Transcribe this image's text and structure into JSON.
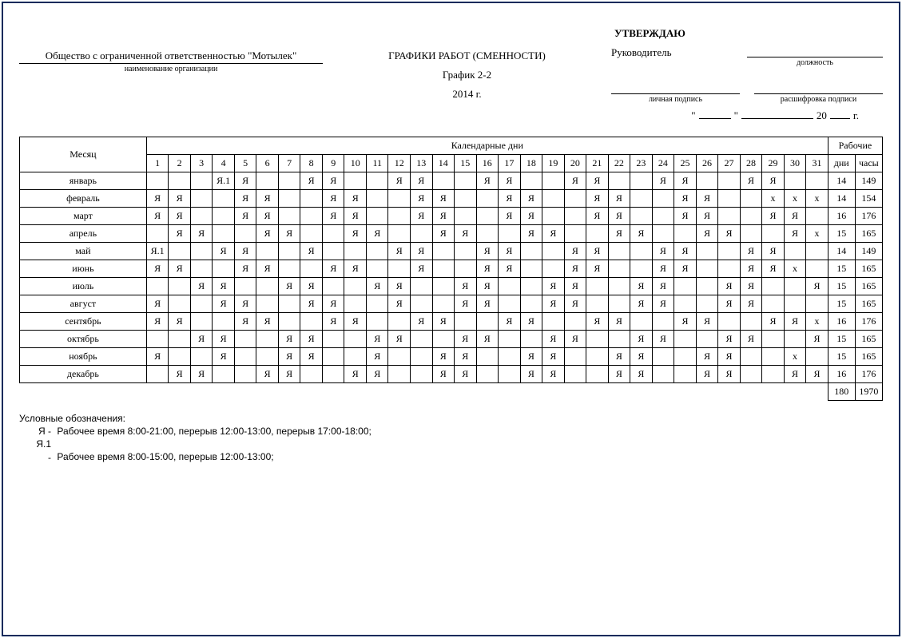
{
  "header": {
    "org_name": "Общество с ограниченной ответственностью \"Мотылек\"",
    "org_label": "наименование организации",
    "title": "ГРАФИКИ РАБОТ (СМЕННОСТИ)",
    "schedule_name": "График 2-2",
    "year": "2014 г."
  },
  "approve": {
    "title": "УТВЕРЖДАЮ",
    "role": "Руководитель",
    "position_label": "должность",
    "sign_label": "личная подпись",
    "decode_label": "расшифровка подписи",
    "year_prefix": "20",
    "year_suffix": "г."
  },
  "table": {
    "month_header": "Месяц",
    "days_header": "Календарные дни",
    "work_header": "Рабочие",
    "dni": "дни",
    "hours": "часы",
    "day_numbers": [
      "1",
      "2",
      "3",
      "4",
      "5",
      "6",
      "7",
      "8",
      "9",
      "10",
      "11",
      "12",
      "13",
      "14",
      "15",
      "16",
      "17",
      "18",
      "19",
      "20",
      "21",
      "22",
      "23",
      "24",
      "25",
      "26",
      "27",
      "28",
      "29",
      "30",
      "31"
    ],
    "rows": [
      {
        "m": "январь",
        "d": [
          "",
          "",
          "",
          "Я.1",
          "Я",
          "",
          "",
          "Я",
          "Я",
          "",
          "",
          "Я",
          "Я",
          "",
          "",
          "Я",
          "Я",
          "",
          "",
          "Я",
          "Я",
          "",
          "",
          "Я",
          "Я",
          "",
          "",
          "Я",
          "Я",
          "",
          ""
        ],
        "days": "14",
        "hrs": "149"
      },
      {
        "m": "февраль",
        "d": [
          "Я",
          "Я",
          "",
          "",
          "Я",
          "Я",
          "",
          "",
          "Я",
          "Я",
          "",
          "",
          "Я",
          "Я",
          "",
          "",
          "Я",
          "Я",
          "",
          "",
          "Я",
          "Я",
          "",
          "",
          "Я",
          "Я",
          "",
          "",
          "х",
          "х",
          "х"
        ],
        "days": "14",
        "hrs": "154"
      },
      {
        "m": "март",
        "d": [
          "Я",
          "Я",
          "",
          "",
          "Я",
          "Я",
          "",
          "",
          "Я",
          "Я",
          "",
          "",
          "Я",
          "Я",
          "",
          "",
          "Я",
          "Я",
          "",
          "",
          "Я",
          "Я",
          "",
          "",
          "Я",
          "Я",
          "",
          "",
          "Я",
          "Я",
          ""
        ],
        "days": "16",
        "hrs": "176"
      },
      {
        "m": "апрель",
        "d": [
          "",
          "Я",
          "Я",
          "",
          "",
          "Я",
          "Я",
          "",
          "",
          "Я",
          "Я",
          "",
          "",
          "Я",
          "Я",
          "",
          "",
          "Я",
          "Я",
          "",
          "",
          "Я",
          "Я",
          "",
          "",
          "Я",
          "Я",
          "",
          "",
          "Я",
          "х"
        ],
        "days": "15",
        "hrs": "165"
      },
      {
        "m": "май",
        "d": [
          "Я.1",
          "",
          "",
          "Я",
          "Я",
          "",
          "",
          "Я",
          "",
          "",
          "",
          "Я",
          "Я",
          "",
          "",
          "Я",
          "Я",
          "",
          "",
          "Я",
          "Я",
          "",
          "",
          "Я",
          "Я",
          "",
          "",
          "Я",
          "Я",
          "",
          ""
        ],
        "days": "14",
        "hrs": "149"
      },
      {
        "m": "июнь",
        "d": [
          "Я",
          "Я",
          "",
          "",
          "Я",
          "Я",
          "",
          "",
          "Я",
          "Я",
          "",
          "",
          "Я",
          "",
          "",
          "Я",
          "Я",
          "",
          "",
          "Я",
          "Я",
          "",
          "",
          "Я",
          "Я",
          "",
          "",
          "Я",
          "Я",
          "х"
        ],
        "days": "15",
        "hrs": "165"
      },
      {
        "m": "июль",
        "d": [
          "",
          "",
          "Я",
          "Я",
          "",
          "",
          "Я",
          "Я",
          "",
          "",
          "Я",
          "Я",
          "",
          "",
          "Я",
          "Я",
          "",
          "",
          "Я",
          "Я",
          "",
          "",
          "Я",
          "Я",
          "",
          "",
          "Я",
          "Я",
          "",
          "",
          "Я"
        ],
        "days": "15",
        "hrs": "165"
      },
      {
        "m": "август",
        "d": [
          "Я",
          "",
          "",
          "Я",
          "Я",
          "",
          "",
          "Я",
          "Я",
          "",
          "",
          "Я",
          "",
          "",
          "Я",
          "Я",
          "",
          "",
          "Я",
          "Я",
          "",
          "",
          "Я",
          "Я",
          "",
          "",
          "Я",
          "Я",
          "",
          "",
          ""
        ],
        "days": "15",
        "hrs": "165"
      },
      {
        "m": "сентябрь",
        "d": [
          "Я",
          "Я",
          "",
          "",
          "Я",
          "Я",
          "",
          "",
          "Я",
          "Я",
          "",
          "",
          "Я",
          "Я",
          "",
          "",
          "Я",
          "Я",
          "",
          "",
          "Я",
          "Я",
          "",
          "",
          "Я",
          "Я",
          "",
          "",
          "Я",
          "Я",
          "х"
        ],
        "days": "16",
        "hrs": "176"
      },
      {
        "m": "октябрь",
        "d": [
          "",
          "",
          "Я",
          "Я",
          "",
          "",
          "Я",
          "Я",
          "",
          "",
          "Я",
          "Я",
          "",
          "",
          "Я",
          "Я",
          "",
          "",
          "Я",
          "Я",
          "",
          "",
          "Я",
          "Я",
          "",
          "",
          "Я",
          "Я",
          "",
          "",
          "Я"
        ],
        "days": "15",
        "hrs": "165"
      },
      {
        "m": "ноябрь",
        "d": [
          "Я",
          "",
          "",
          "Я",
          "",
          "",
          "Я",
          "Я",
          "",
          "",
          "Я",
          "",
          "",
          "Я",
          "Я",
          "",
          "",
          "Я",
          "Я",
          "",
          "",
          "Я",
          "Я",
          "",
          "",
          "Я",
          "Я",
          "",
          "",
          "х"
        ],
        "days": "15",
        "hrs": "165"
      },
      {
        "m": "декабрь",
        "d": [
          "",
          "Я",
          "Я",
          "",
          "",
          "Я",
          "Я",
          "",
          "",
          "Я",
          "Я",
          "",
          "",
          "Я",
          "Я",
          "",
          "",
          "Я",
          "Я",
          "",
          "",
          "Я",
          "Я",
          "",
          "",
          "Я",
          "Я",
          "",
          "",
          "Я",
          "Я"
        ],
        "days": "16",
        "hrs": "176"
      }
    ],
    "total_days": "180",
    "total_hours": "1970"
  },
  "legend": {
    "title": "Условные обозначения:",
    "items": [
      {
        "code": "Я",
        "text": "Рабочее время 8:00-21:00, перерыв 12:00-13:00, перерыв 17:00-18:00;"
      },
      {
        "code": "Я.1",
        "text": "Рабочее время 8:00-15:00, перерыв 12:00-13:00;"
      }
    ]
  }
}
